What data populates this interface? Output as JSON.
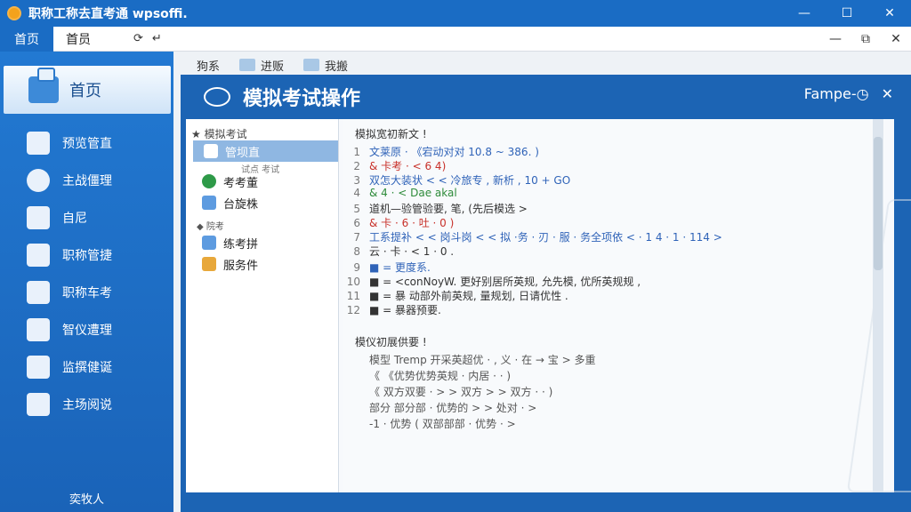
{
  "titlebar": {
    "title": "职称工称去直考通 wpsoffi.",
    "min": "—",
    "max": "☐",
    "close": "✕"
  },
  "tabbar": {
    "tab_active": "首页",
    "tab_other": "首员",
    "tools": [
      "⟳",
      "↵"
    ],
    "inner_min": "—",
    "inner_max": "⧉",
    "inner_close": "✕"
  },
  "sidebar": {
    "home_label": "首页",
    "items": [
      {
        "label": "预览管直"
      },
      {
        "label": "主战僵理"
      },
      {
        "label": "自尼"
      },
      {
        "label": "职称管捷"
      },
      {
        "label": "职称车考"
      },
      {
        "label": "智仪遭理"
      },
      {
        "label": "监撰健诞"
      },
      {
        "label": "主场阅说"
      }
    ],
    "footer": "奕牧人"
  },
  "content_tabs": [
    "狗系",
    "进贩",
    "我搬"
  ],
  "panel": {
    "title": "模拟考试操作",
    "right_label": "Fampe-◷",
    "close": "✕"
  },
  "tree": {
    "root": "★ 模拟考试",
    "selected": "管坝直",
    "note": "试点 考试",
    "items": [
      {
        "label": "考考董"
      },
      {
        "label": "台旋株"
      }
    ],
    "group": "◆ 院考",
    "items2": [
      {
        "label": "练考拼"
      },
      {
        "label": "服务件"
      }
    ]
  },
  "editor": {
    "header": "模拟宽初新文 !",
    "lines": [
      {
        "n": "1",
        "text": "文莱原 · 《宕动对对 10.8 ~ 386. )"
      },
      {
        "n": "2",
        "text": "& 卡考 · < 6 4)"
      },
      {
        "n": "3",
        "text": "双怎大装状 < < 冷旅专 , 新析 , 10 + GO"
      },
      {
        "n": "4",
        "text": "& 4 · <  Dae akal"
      },
      {
        "n": "5",
        "text": "道机—验管验要, 笔, (先后模选 >"
      },
      {
        "n": "6",
        "text": "& 卡 · 6 · 吐 · 0 )"
      },
      {
        "n": "7",
        "text": "工系提补 < < 岗斗岗 < < 拟 ·务 · 刃 ·  服 · 务全项依 < · 1 4 · 1 · 114 >"
      },
      {
        "n": "8",
        "text": "云 · 卡 · < 1 · 0 ."
      },
      {
        "n": "9",
        "text": "■ = 更度系."
      },
      {
        "n": "10",
        "text": "■ = <conNoyW. 更好别居所英规, 允先模, 优所英规规 ,"
      },
      {
        "n": "11",
        "text": "■ = 暴 动部外前英规, 量规划, 日请优性 ."
      },
      {
        "n": "12",
        "text": "■ = 暴器预要."
      }
    ],
    "section2": "模仪初展供要 !",
    "lines2": [
      {
        "text": "模型 Tremp 开采英超优 ·  , 义 · 在 → 宝 > 多重"
      },
      {
        "text": "《 《优势优势英规 · 内居 · · )"
      },
      {
        "text": "《 双方双要 · > > 双方 > > 双方 · · )"
      },
      {
        "text": "部分  部分部 · 优势的 > > 处对 · >"
      },
      {
        "text": "-1 ·  优势 (  双部部部 · 优势 · >"
      }
    ]
  },
  "colors": {
    "accent": "#1a6cc4",
    "sidebar": "#2279d2",
    "panel": "#1c64b4"
  }
}
